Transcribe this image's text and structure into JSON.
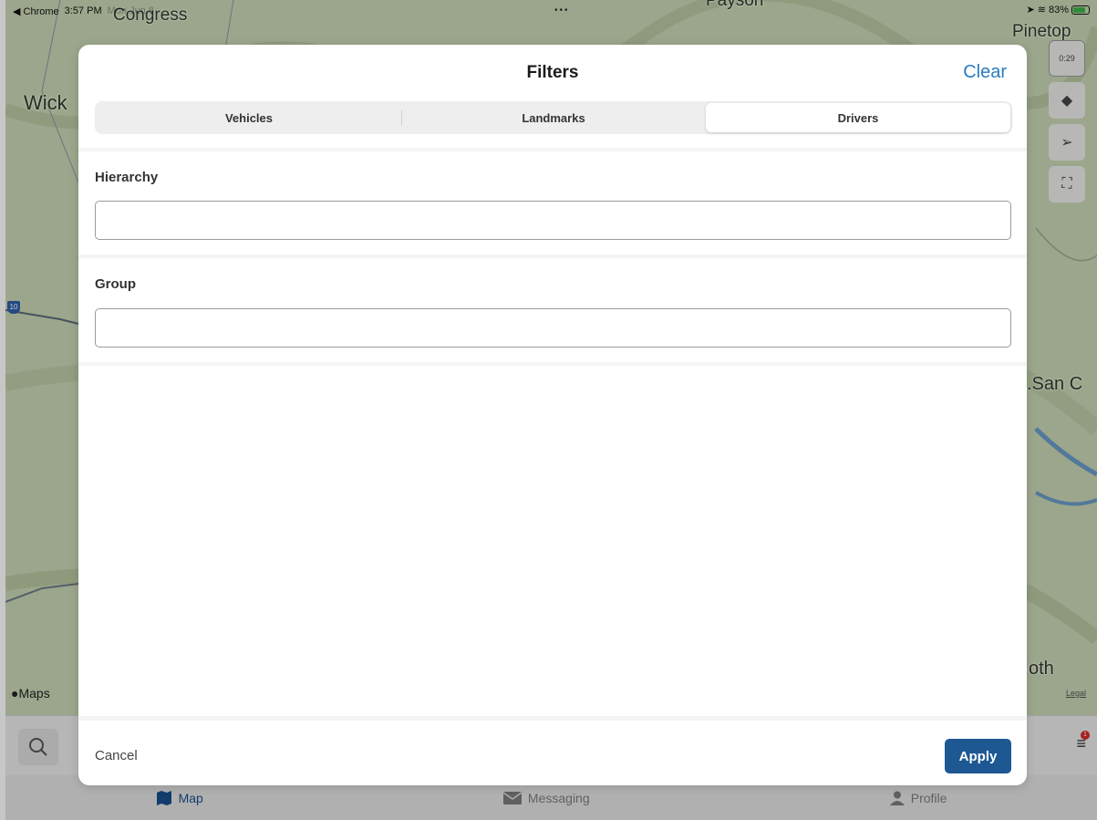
{
  "status_bar": {
    "back_app": "◀ Chrome",
    "time": "3:57 PM",
    "date": "Mon Jun 8",
    "dots": "•••",
    "battery_percent": "83%",
    "battery_level": 0.83
  },
  "map": {
    "labels": {
      "congress": "Congress",
      "wick": "Wick",
      "pinetop": "Pinetop",
      "san_c": ".San C",
      "oth": "oth",
      "payson": "Payson"
    },
    "interstate_shield": "10",
    "attribution": "Maps",
    "legal": "Legal",
    "controls": {
      "timer": "0:29"
    }
  },
  "modal": {
    "title": "Filters",
    "clear_label": "Clear",
    "tabs": [
      {
        "label": "Vehicles",
        "selected": false
      },
      {
        "label": "Landmarks",
        "selected": false
      },
      {
        "label": "Drivers",
        "selected": true
      }
    ],
    "fields": {
      "hierarchy": {
        "label": "Hierarchy",
        "value": "",
        "placeholder": ""
      },
      "group": {
        "label": "Group",
        "value": "",
        "placeholder": ""
      }
    },
    "cancel_label": "Cancel",
    "apply_label": "Apply"
  },
  "filter_badge": "1",
  "tabbar": {
    "items": [
      {
        "label": "Map",
        "icon": "map-icon",
        "active": true
      },
      {
        "label": "Messaging",
        "icon": "envelope-icon",
        "active": false
      },
      {
        "label": "Profile",
        "icon": "person-icon",
        "active": false
      }
    ]
  },
  "colors": {
    "accent": "#2b7bbf",
    "apply_button": "#1d5893",
    "active_tab": "#174e8c",
    "badge": "#d62a2a"
  }
}
